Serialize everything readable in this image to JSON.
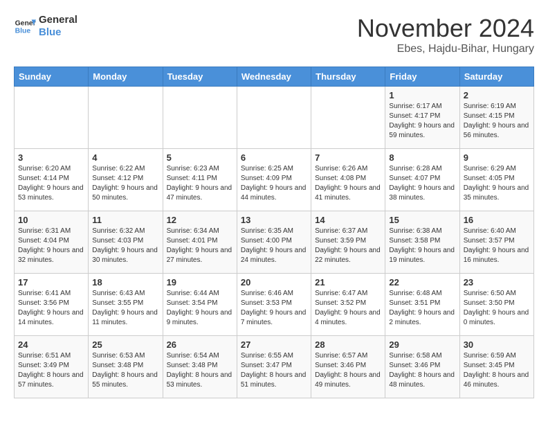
{
  "logo": {
    "line1": "General",
    "line2": "Blue"
  },
  "title": "November 2024",
  "subtitle": "Ebes, Hajdu-Bihar, Hungary",
  "days_header": [
    "Sunday",
    "Monday",
    "Tuesday",
    "Wednesday",
    "Thursday",
    "Friday",
    "Saturday"
  ],
  "weeks": [
    [
      {
        "day": "",
        "info": ""
      },
      {
        "day": "",
        "info": ""
      },
      {
        "day": "",
        "info": ""
      },
      {
        "day": "",
        "info": ""
      },
      {
        "day": "",
        "info": ""
      },
      {
        "day": "1",
        "info": "Sunrise: 6:17 AM\nSunset: 4:17 PM\nDaylight: 9 hours and 59 minutes."
      },
      {
        "day": "2",
        "info": "Sunrise: 6:19 AM\nSunset: 4:15 PM\nDaylight: 9 hours and 56 minutes."
      }
    ],
    [
      {
        "day": "3",
        "info": "Sunrise: 6:20 AM\nSunset: 4:14 PM\nDaylight: 9 hours and 53 minutes."
      },
      {
        "day": "4",
        "info": "Sunrise: 6:22 AM\nSunset: 4:12 PM\nDaylight: 9 hours and 50 minutes."
      },
      {
        "day": "5",
        "info": "Sunrise: 6:23 AM\nSunset: 4:11 PM\nDaylight: 9 hours and 47 minutes."
      },
      {
        "day": "6",
        "info": "Sunrise: 6:25 AM\nSunset: 4:09 PM\nDaylight: 9 hours and 44 minutes."
      },
      {
        "day": "7",
        "info": "Sunrise: 6:26 AM\nSunset: 4:08 PM\nDaylight: 9 hours and 41 minutes."
      },
      {
        "day": "8",
        "info": "Sunrise: 6:28 AM\nSunset: 4:07 PM\nDaylight: 9 hours and 38 minutes."
      },
      {
        "day": "9",
        "info": "Sunrise: 6:29 AM\nSunset: 4:05 PM\nDaylight: 9 hours and 35 minutes."
      }
    ],
    [
      {
        "day": "10",
        "info": "Sunrise: 6:31 AM\nSunset: 4:04 PM\nDaylight: 9 hours and 32 minutes."
      },
      {
        "day": "11",
        "info": "Sunrise: 6:32 AM\nSunset: 4:03 PM\nDaylight: 9 hours and 30 minutes."
      },
      {
        "day": "12",
        "info": "Sunrise: 6:34 AM\nSunset: 4:01 PM\nDaylight: 9 hours and 27 minutes."
      },
      {
        "day": "13",
        "info": "Sunrise: 6:35 AM\nSunset: 4:00 PM\nDaylight: 9 hours and 24 minutes."
      },
      {
        "day": "14",
        "info": "Sunrise: 6:37 AM\nSunset: 3:59 PM\nDaylight: 9 hours and 22 minutes."
      },
      {
        "day": "15",
        "info": "Sunrise: 6:38 AM\nSunset: 3:58 PM\nDaylight: 9 hours and 19 minutes."
      },
      {
        "day": "16",
        "info": "Sunrise: 6:40 AM\nSunset: 3:57 PM\nDaylight: 9 hours and 16 minutes."
      }
    ],
    [
      {
        "day": "17",
        "info": "Sunrise: 6:41 AM\nSunset: 3:56 PM\nDaylight: 9 hours and 14 minutes."
      },
      {
        "day": "18",
        "info": "Sunrise: 6:43 AM\nSunset: 3:55 PM\nDaylight: 9 hours and 11 minutes."
      },
      {
        "day": "19",
        "info": "Sunrise: 6:44 AM\nSunset: 3:54 PM\nDaylight: 9 hours and 9 minutes."
      },
      {
        "day": "20",
        "info": "Sunrise: 6:46 AM\nSunset: 3:53 PM\nDaylight: 9 hours and 7 minutes."
      },
      {
        "day": "21",
        "info": "Sunrise: 6:47 AM\nSunset: 3:52 PM\nDaylight: 9 hours and 4 minutes."
      },
      {
        "day": "22",
        "info": "Sunrise: 6:48 AM\nSunset: 3:51 PM\nDaylight: 9 hours and 2 minutes."
      },
      {
        "day": "23",
        "info": "Sunrise: 6:50 AM\nSunset: 3:50 PM\nDaylight: 9 hours and 0 minutes."
      }
    ],
    [
      {
        "day": "24",
        "info": "Sunrise: 6:51 AM\nSunset: 3:49 PM\nDaylight: 8 hours and 57 minutes."
      },
      {
        "day": "25",
        "info": "Sunrise: 6:53 AM\nSunset: 3:48 PM\nDaylight: 8 hours and 55 minutes."
      },
      {
        "day": "26",
        "info": "Sunrise: 6:54 AM\nSunset: 3:48 PM\nDaylight: 8 hours and 53 minutes."
      },
      {
        "day": "27",
        "info": "Sunrise: 6:55 AM\nSunset: 3:47 PM\nDaylight: 8 hours and 51 minutes."
      },
      {
        "day": "28",
        "info": "Sunrise: 6:57 AM\nSunset: 3:46 PM\nDaylight: 8 hours and 49 minutes."
      },
      {
        "day": "29",
        "info": "Sunrise: 6:58 AM\nSunset: 3:46 PM\nDaylight: 8 hours and 48 minutes."
      },
      {
        "day": "30",
        "info": "Sunrise: 6:59 AM\nSunset: 3:45 PM\nDaylight: 8 hours and 46 minutes."
      }
    ]
  ]
}
